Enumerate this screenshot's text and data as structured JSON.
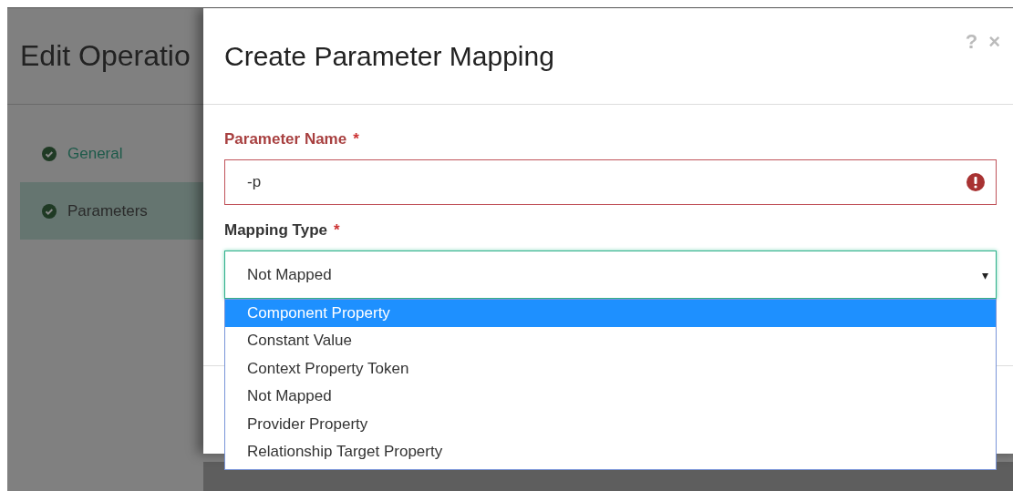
{
  "page": {
    "title": "Edit Operatio",
    "steps": [
      {
        "label": "General",
        "selected": false
      },
      {
        "label": "Parameters",
        "selected": true
      }
    ]
  },
  "modal": {
    "title": "Create Parameter Mapping",
    "help": "?",
    "close": "×",
    "fields": [
      {
        "kind": "text",
        "label": "Parameter Name",
        "required": "*",
        "value": "-p",
        "invalid": true
      },
      {
        "kind": "select",
        "label": "Mapping Type",
        "required": "*",
        "value": "Not Mapped",
        "caret": "▾",
        "expanded": true,
        "options": [
          {
            "label": "Component Property",
            "highlighted": true
          },
          {
            "label": "Constant Value",
            "highlighted": false
          },
          {
            "label": "Context Property Token",
            "highlighted": false
          },
          {
            "label": "Not Mapped",
            "highlighted": false
          },
          {
            "label": "Provider Property",
            "highlighted": false
          },
          {
            "label": "Relationship Target Property",
            "highlighted": false
          }
        ]
      }
    ]
  }
}
